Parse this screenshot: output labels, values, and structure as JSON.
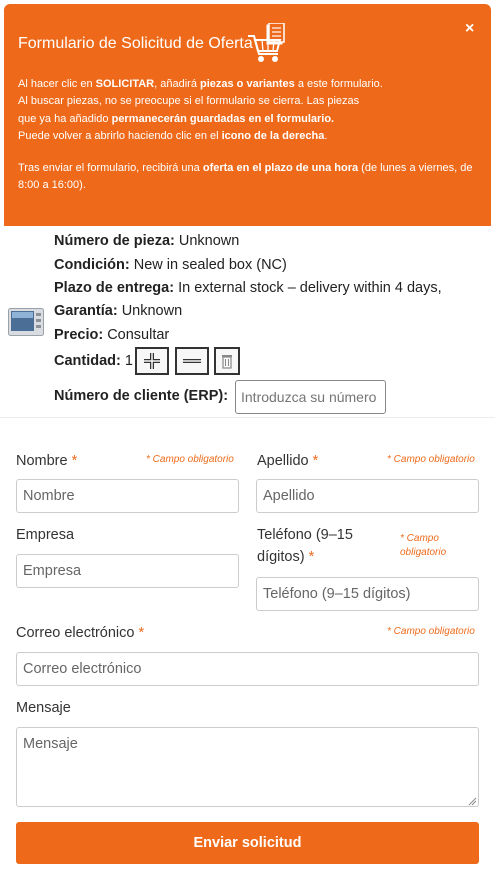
{
  "header": {
    "title": "Formulario de Solicitud de Oferta",
    "close": "×",
    "icon": "cart-document-icon",
    "intro": {
      "l1_a": "Al hacer clic en ",
      "l1_b": "SOLICITAR",
      "l1_c": ", añadirá ",
      "l1_d": "piezas o variantes",
      "l1_e": " a este formulario.",
      "l2": "Al buscar piezas, no se preocupe si el formulario se cierra. Las piezas",
      "l3_a": "que ya ha añadido ",
      "l3_b": "permanecerán guardadas en el formulario.",
      "l4_a": "Puede volver a abrirlo haciendo clic en el ",
      "l4_b": "icono de la derecha",
      "l4_c": ".",
      "p2_a": "Tras enviar el formulario, recibirá una ",
      "p2_b": "oferta en el plazo de una hora",
      "p2_c": " (de lunes a viernes, de 8:00 a 16:00)."
    }
  },
  "product": {
    "part_label": "Número de pieza:",
    "part_value": " Unknown",
    "condition_label": "Condición:",
    "condition_value": " New in sealed box (NC)",
    "delivery_label": "Plazo de entrega:",
    "delivery_value": " In external stock – delivery within 4 days,",
    "warranty_label": "Garantía:",
    "warranty_value": " Unknown",
    "price_label": "Precio:",
    "price_value": " Consultar",
    "qty_label": "Cantidad:",
    "qty_value": " 1",
    "erp_label": "Número de cliente (ERP):",
    "erp_placeholder": "Introduzca su número"
  },
  "form": {
    "required_note": "* Campo obligatorio",
    "required_note_l1": "* Campo",
    "required_note_l2": "obligatorio",
    "star": " *",
    "first_name": {
      "label": "Nombre",
      "placeholder": "Nombre"
    },
    "last_name": {
      "label": "Apellido",
      "placeholder": "Apellido"
    },
    "company": {
      "label": "Empresa",
      "placeholder": "Empresa"
    },
    "phone": {
      "label_l1": "Teléfono (9–15",
      "label_l2": "dígitos)",
      "placeholder": "Teléfono (9–15 dígitos)"
    },
    "email": {
      "label": "Correo electrónico",
      "placeholder": "Correo electrónico"
    },
    "message": {
      "label": "Mensaje",
      "placeholder": "Mensaje"
    },
    "submit": "Enviar solicitud"
  },
  "colors": {
    "accent": "#ee6a1a"
  }
}
